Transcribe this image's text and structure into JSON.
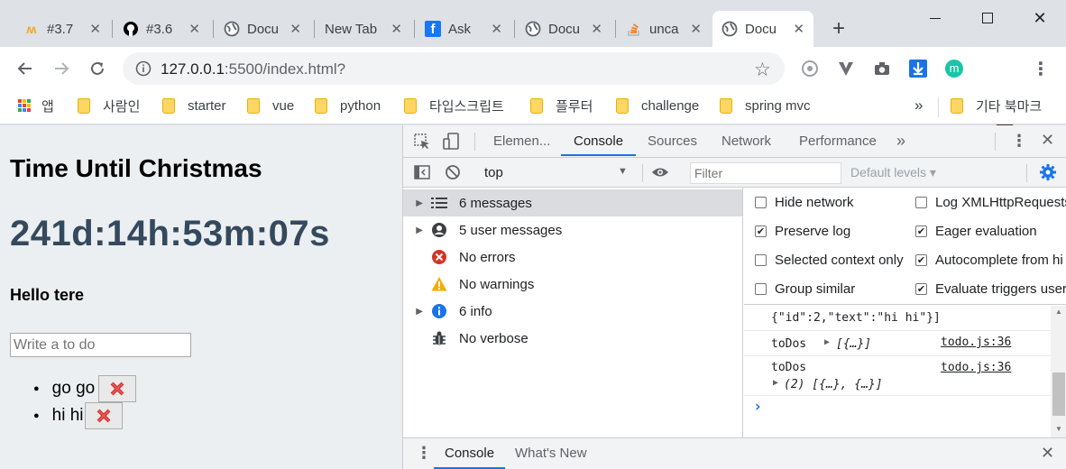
{
  "tabs": [
    {
      "title": "#3.7",
      "favicon": "brand-m-icon",
      "favicon_color": "#f5a623"
    },
    {
      "title": "#3.6",
      "favicon": "github-icon",
      "favicon_color": "#000000"
    },
    {
      "title": "Docu",
      "favicon": "globe-icon",
      "favicon_color": "#5f6368"
    },
    {
      "title": "New Tab",
      "favicon": "",
      "favicon_color": ""
    },
    {
      "title": "Ask",
      "favicon": "facebook-icon",
      "favicon_color": "#1877f2"
    },
    {
      "title": "Docu",
      "favicon": "globe-icon",
      "favicon_color": "#5f6368"
    },
    {
      "title": "unca",
      "favicon": "stackoverflow-icon",
      "favicon_color": "#f48024"
    },
    {
      "title": "Docu",
      "favicon": "globe-icon",
      "favicon_color": "#5f6368",
      "active": true
    }
  ],
  "toolbar": {
    "url_host": "127.0.0.1",
    "url_rest": ":5500/index.html?"
  },
  "bookmarks": {
    "apps_label": "앱",
    "items": [
      "사람인",
      "starter",
      "vue",
      "python",
      "타입스크립트",
      "플루터",
      "challenge",
      "spring mvc"
    ],
    "overflow": "»",
    "other": "기타 북마크"
  },
  "page": {
    "title": "Time Until Christmas",
    "countdown": "241d:14h:53m:07s",
    "greeting": "Hello tere",
    "input_placeholder": "Write a to do",
    "todos": [
      "go go",
      "hi hi"
    ]
  },
  "devtools": {
    "tabs": [
      "Elemen...",
      "Console",
      "Sources",
      "Network",
      "Performance"
    ],
    "active_tab": "Console",
    "more": "»",
    "context": "top",
    "filter_placeholder": "Filter",
    "levels": "Default levels",
    "sidebar": [
      {
        "label": "6 messages",
        "icon": "list-icon",
        "expandable": true
      },
      {
        "label": "5 user messages",
        "icon": "user-icon",
        "expandable": true
      },
      {
        "label": "No errors",
        "icon": "error-icon",
        "expandable": false
      },
      {
        "label": "No warnings",
        "icon": "warning-icon",
        "expandable": false
      },
      {
        "label": "6 info",
        "icon": "info-icon",
        "expandable": true
      },
      {
        "label": "No verbose",
        "icon": "bug-icon",
        "expandable": false
      }
    ],
    "settings": [
      {
        "label": "Hide network",
        "checked": false
      },
      {
        "label": "Log XMLHttpRequests",
        "checked": false
      },
      {
        "label": "Preserve log",
        "checked": true
      },
      {
        "label": "Eager evaluation",
        "checked": true
      },
      {
        "label": "Selected context only",
        "checked": false
      },
      {
        "label": "Autocomplete from hi",
        "checked": true
      },
      {
        "label": "Group similar",
        "checked": false
      },
      {
        "label": "Evaluate triggers user",
        "checked": true
      }
    ],
    "console": {
      "partial_line": "{\"id\":2,\"text\":\"hi hi\"}]",
      "row1_name": "toDos",
      "row1_value": "[{…}]",
      "row1_source": "todo.js:36",
      "row2_name": "toDos",
      "row2_value": "(2) [{…}, {…}]",
      "row2_source": "todo.js:36",
      "prompt": "›"
    },
    "drawer_tabs": [
      "Console",
      "What's New"
    ]
  },
  "colors": {
    "accent": "#1a73e8",
    "countdown": "#34495e",
    "error": "#d93025",
    "warning": "#f9ab00",
    "info": "#1a73e8"
  }
}
